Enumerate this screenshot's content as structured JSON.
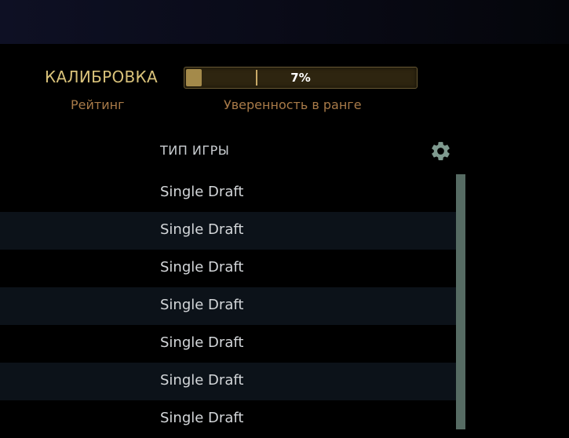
{
  "calibration": {
    "title": "КАЛИБРОВКА",
    "rating_label": "Рейтинг",
    "confidence_label": "Уверенность в ранге",
    "confidence_value": "7%",
    "confidence_fraction": 0.07
  },
  "table": {
    "column_header": "ТИП ИГРЫ",
    "settings_icon": "gear-icon",
    "rows": [
      "Single Draft",
      "Single Draft",
      "Single Draft",
      "Single Draft",
      "Single Draft",
      "Single Draft",
      "Single Draft"
    ]
  },
  "colors": {
    "gold_text": "#d9c27a",
    "bronze_text": "#a87a48",
    "bar_fill": "#a48a4a",
    "scroll_thumb": "#566b63"
  }
}
